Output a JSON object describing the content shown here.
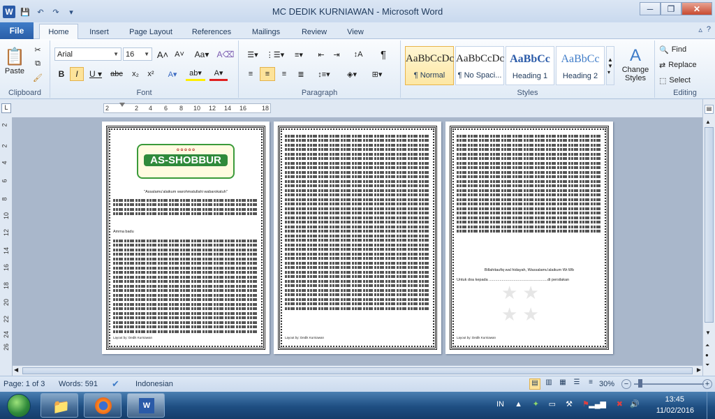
{
  "window": {
    "title": "MC DEDIK KURNIAWAN  -  Microsoft Word"
  },
  "tabs": {
    "file": "File",
    "items": [
      "Home",
      "Insert",
      "Page Layout",
      "References",
      "Mailings",
      "Review",
      "View"
    ]
  },
  "clipboard": {
    "paste": "Paste",
    "label": "Clipboard"
  },
  "font": {
    "name": "Arial",
    "size": "16",
    "label": "Font"
  },
  "paragraph": {
    "label": "Paragraph"
  },
  "styles": {
    "label": "Styles",
    "items": [
      {
        "preview": "AaBbCcDc",
        "name": "¶ Normal"
      },
      {
        "preview": "AaBbCcDc",
        "name": "¶ No Spaci..."
      },
      {
        "preview": "AaBbCc",
        "name": "Heading 1"
      },
      {
        "preview": "AaBbCc",
        "name": "Heading 2"
      }
    ],
    "change": "Change Styles"
  },
  "editing": {
    "label": "Editing",
    "find": "Find",
    "replace": "Replace",
    "select": "Select"
  },
  "ruler": {
    "ticks": [
      "2",
      "2",
      "4",
      "6",
      "8",
      "10",
      "12",
      "14",
      "16",
      "18"
    ]
  },
  "vruler": {
    "ticks": [
      "2",
      "2",
      "4",
      "6",
      "8",
      "10",
      "12",
      "14",
      "16",
      "18",
      "20",
      "22",
      "24",
      "26"
    ]
  },
  "document": {
    "logo_text": "AS-SHOBBUR",
    "greeting": "\"Assalamu'alaikum warohmatullahi wabarokatuh\"",
    "ammabadu": "Amma badu",
    "closing": "Billahitaufiq wal hidayah, Wassalamu'alaikum Wr.Wb",
    "untuk": "Untuk doa kepada .......................................................di persilakan",
    "footer": "Layout by: Dedik Kurniawan"
  },
  "status": {
    "page": "Page: 1 of 3",
    "words": "Words: 591",
    "lang": "Indonesian",
    "zoom": "30%"
  },
  "tray": {
    "lang": "IN",
    "time": "13:45",
    "date": "11/02/2016"
  }
}
